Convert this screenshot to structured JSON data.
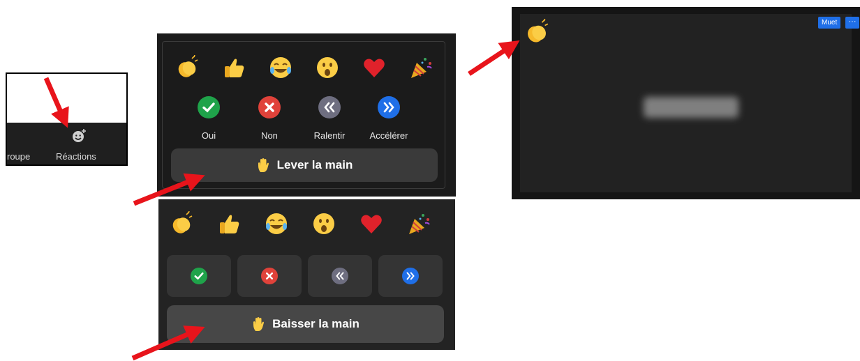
{
  "toolbar": {
    "group_label": "roupe",
    "reactions_label": "Réactions",
    "icons": [
      "smiley-plus-icon"
    ]
  },
  "reactions_panel": {
    "emojis": [
      "clap",
      "thumbs-up",
      "tears-of-joy",
      "surprised",
      "heart",
      "party-popper"
    ],
    "responses": [
      {
        "label": "Oui",
        "icon": "check-icon",
        "color": "#1fa34a"
      },
      {
        "label": "Non",
        "icon": "x-icon",
        "color": "#e0423a"
      },
      {
        "label": "Ralentir",
        "icon": "rewind-icon",
        "color": "#6e6e80"
      },
      {
        "label": "Accélérer",
        "icon": "fast-forward-icon",
        "color": "#1f6fe8"
      }
    ],
    "raise_hand_label": "Lever la main"
  },
  "reactions_panel_after": {
    "emojis": [
      "clap",
      "thumbs-up",
      "tears-of-joy",
      "surprised",
      "heart",
      "party-popper"
    ],
    "lower_hand_label": "Baisser la main"
  },
  "video_tile": {
    "mute_label": "Muet",
    "more_label": "···",
    "reaction": "clap"
  },
  "colors": {
    "arrow": "#e8141b",
    "panel_bg": "#1b1b1b",
    "button_bg": "#3a3a3a",
    "accent_blue": "#1f6fe8"
  }
}
